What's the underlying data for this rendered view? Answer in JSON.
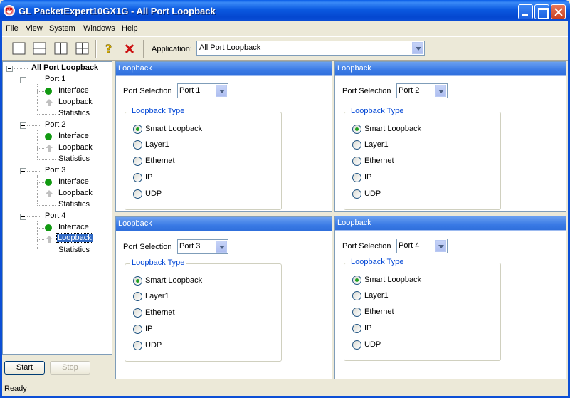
{
  "window": {
    "title": "GL PacketExpert10GX1G - All Port Loopback",
    "icon": "app-logo-icon"
  },
  "menu": [
    "File",
    "View",
    "System",
    "Windows",
    "Help"
  ],
  "toolbar": {
    "application_label": "Application:",
    "application_value": "All Port Loopback",
    "icons": [
      "single-view-icon",
      "horizontal-split-icon",
      "vertical-split-icon",
      "quad-view-icon",
      "help-icon",
      "close-red-x-icon"
    ]
  },
  "tree": {
    "root": "All Port Loopback",
    "ports": [
      {
        "label": "Port 1",
        "children": [
          "Interface",
          "Loopback",
          "Statistics"
        ]
      },
      {
        "label": "Port 2",
        "children": [
          "Interface",
          "Loopback",
          "Statistics"
        ]
      },
      {
        "label": "Port 3",
        "children": [
          "Interface",
          "Loopback",
          "Statistics"
        ]
      },
      {
        "label": "Port 4",
        "children": [
          "Interface",
          "Loopback",
          "Statistics"
        ]
      }
    ],
    "selected": "Port 4 / Loopback"
  },
  "buttons": {
    "start": "Start",
    "stop": "Stop"
  },
  "panels": [
    {
      "header": "Loopback",
      "port_label": "Port Selection",
      "port_value": "Port 1",
      "group_title": "Loopback Type",
      "options": [
        "Smart Loopback",
        "Layer1",
        "Ethernet",
        "IP",
        "UDP"
      ],
      "selected_option": "Smart Loopback"
    },
    {
      "header": "Loopback",
      "port_label": "Port Selection",
      "port_value": "Port 2",
      "group_title": "Loopback Type",
      "options": [
        "Smart Loopback",
        "Layer1",
        "Ethernet",
        "IP",
        "UDP"
      ],
      "selected_option": "Smart Loopback"
    },
    {
      "header": "Loopback",
      "port_label": "Port Selection",
      "port_value": "Port 3",
      "group_title": "Loopback Type",
      "options": [
        "Smart Loopback",
        "Layer1",
        "Ethernet",
        "IP",
        "UDP"
      ],
      "selected_option": "Smart Loopback"
    },
    {
      "header": "Loopback",
      "port_label": "Port Selection",
      "port_value": "Port 4",
      "group_title": "Loopback Type",
      "options": [
        "Smart Loopback",
        "Layer1",
        "Ethernet",
        "IP",
        "UDP"
      ],
      "selected_option": "Smart Loopback"
    }
  ],
  "status": "Ready",
  "colors": {
    "title_bar": "#0b59e0",
    "panel_header": "#3a7ae5",
    "status_green": "#119911",
    "selection": "#316ac5"
  }
}
